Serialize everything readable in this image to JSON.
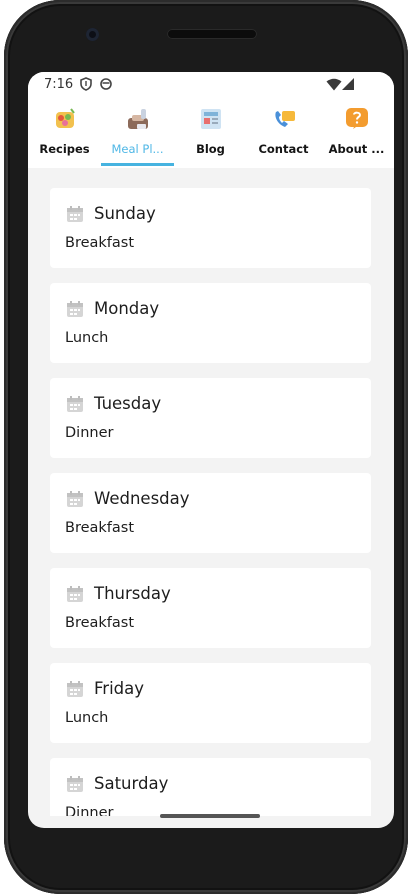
{
  "status_bar": {
    "time": "7:16"
  },
  "tabs": [
    {
      "label": "Recipes",
      "icon": "salad-icon"
    },
    {
      "label": "Meal Pl...",
      "icon": "meal-plan-icon"
    },
    {
      "label": "Blog",
      "icon": "newspaper-icon"
    },
    {
      "label": "Contact",
      "icon": "phone-message-icon"
    },
    {
      "label": "About ...",
      "icon": "question-icon"
    }
  ],
  "active_tab": "Meal Pl...",
  "colors": {
    "accent": "#46b3e0",
    "card": "#ffffff",
    "background": "#f3f3f3"
  },
  "meal_plan": [
    {
      "day": "Sunday",
      "meal": "Breakfast"
    },
    {
      "day": "Monday",
      "meal": "Lunch"
    },
    {
      "day": "Tuesday",
      "meal": "Dinner"
    },
    {
      "day": "Wednesday",
      "meal": "Breakfast"
    },
    {
      "day": "Thursday",
      "meal": "Breakfast"
    },
    {
      "day": "Friday",
      "meal": "Lunch"
    },
    {
      "day": "Saturday",
      "meal": "Dinner"
    }
  ]
}
